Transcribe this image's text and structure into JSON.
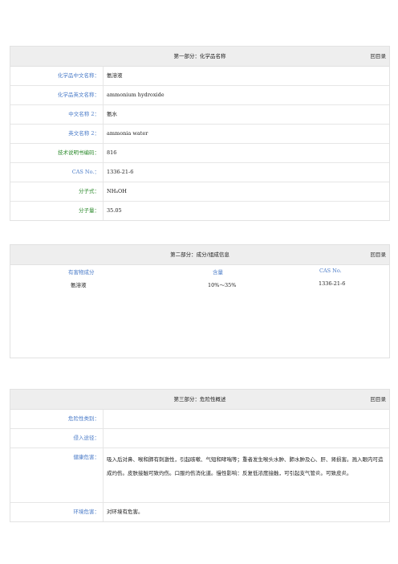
{
  "back_label": "回目录",
  "section1": {
    "title": "第一部分：化学品名称",
    "rows": [
      {
        "label": "化学品中文名称：",
        "value": "氨溶液"
      },
      {
        "label": "化学品英文名称：",
        "value": "ammonium hydroxide"
      },
      {
        "label": "中文名称 2：",
        "value": "氨水"
      },
      {
        "label": "英文名称 2：",
        "value": "ammonia water"
      },
      {
        "label": "技术说明书编码：",
        "value": "816"
      },
      {
        "label": "CAS No.：",
        "value": "1336-21-6"
      },
      {
        "label": "分子式：",
        "value": "NH₄OH"
      },
      {
        "label": "分子量：",
        "value": "35.05"
      }
    ]
  },
  "section2": {
    "title": "第二部分：成分/组成信息",
    "headers": [
      "有害物成分",
      "含量",
      "CAS No."
    ],
    "row": [
      "氨溶液",
      "10%～35%",
      "1336-21-6"
    ]
  },
  "section3": {
    "title": "第三部分：危险性概述",
    "rows": [
      {
        "label": "危险性类别：",
        "value": ""
      },
      {
        "label": "侵入途径：",
        "value": ""
      },
      {
        "label": "健康危害：",
        "value": "吸入后对鼻、喉和肺有刺激性，引起咳嗽、气短和哮喘等；重者发生喉头水肿、肺水肿及心、肝、肾损害。溅入眼内可造成灼伤。皮肤接触可致灼伤。口服灼伤消化道。慢性影响：反复低浓度接触，可引起支气管炎。可致皮炎。"
      },
      {
        "label": "环境危害：",
        "value": "对环境有危害。"
      }
    ]
  }
}
